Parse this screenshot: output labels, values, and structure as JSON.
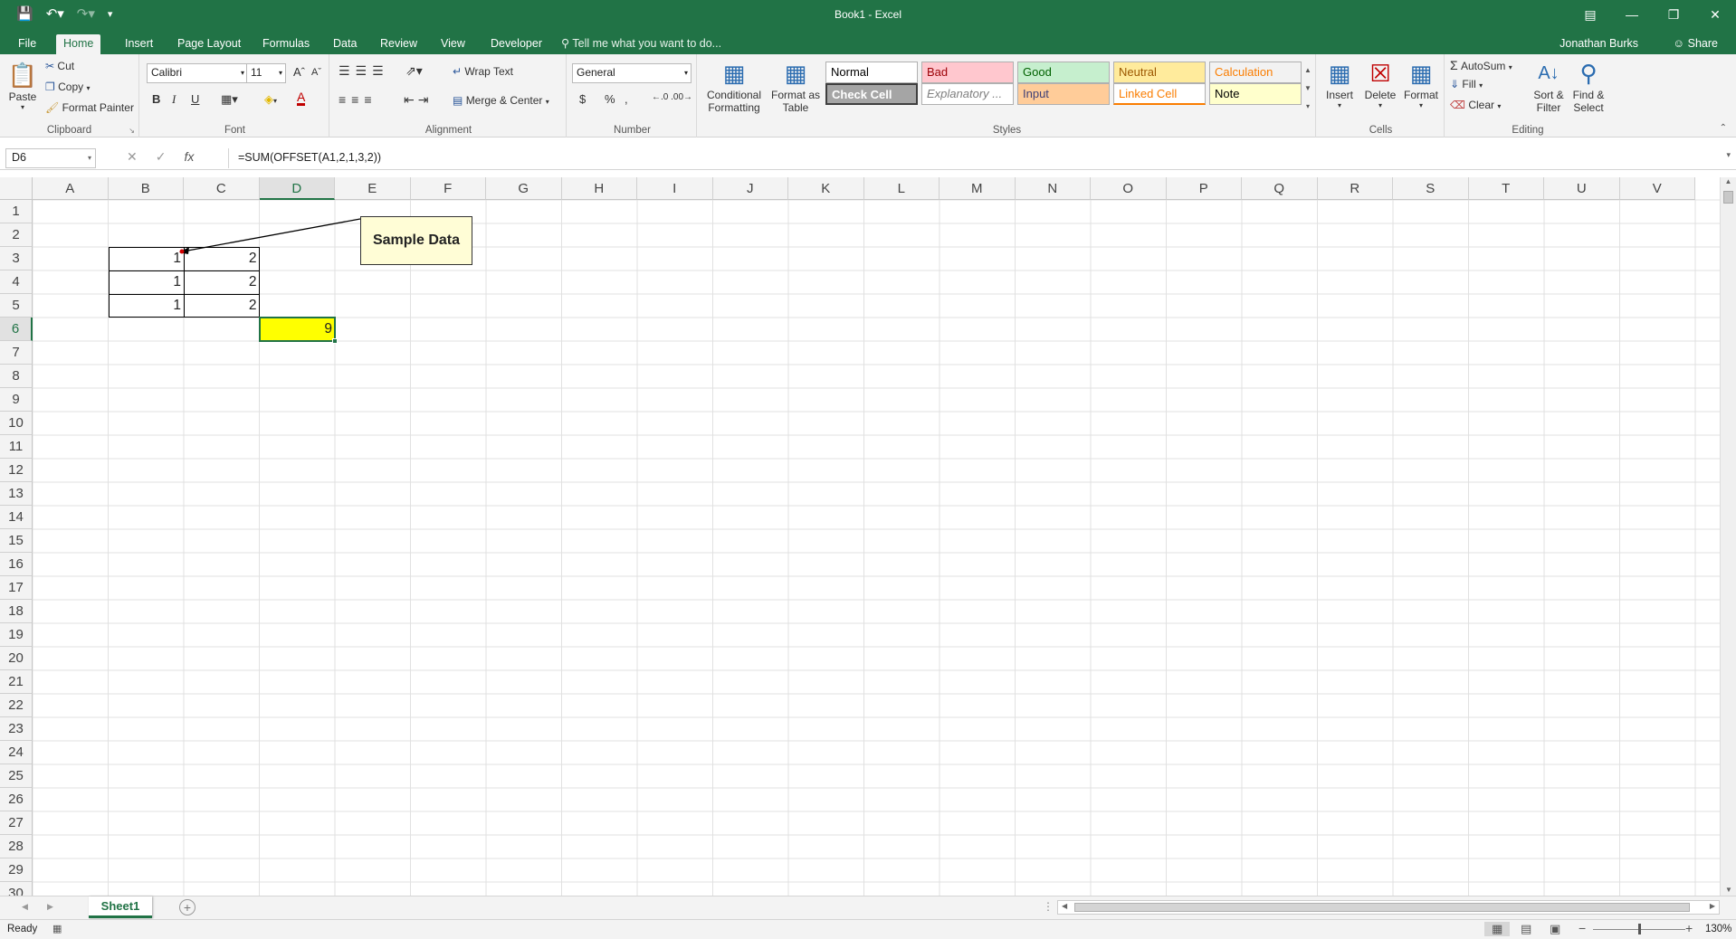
{
  "window": {
    "title": "Book1 - Excel",
    "accent_color": "#217346"
  },
  "tabs": [
    {
      "label": "File"
    },
    {
      "label": "Home"
    },
    {
      "label": "Insert"
    },
    {
      "label": "Page Layout"
    },
    {
      "label": "Formulas"
    },
    {
      "label": "Data"
    },
    {
      "label": "Review"
    },
    {
      "label": "View"
    },
    {
      "label": "Developer"
    }
  ],
  "active_tab": "Home",
  "tell_me": "Tell me what you want to do...",
  "user_name": "Jonathan Burks",
  "share_label": "Share",
  "ribbon": {
    "clipboard": {
      "label": "Clipboard",
      "paste": "Paste",
      "cut": "Cut",
      "copy": "Copy",
      "format_painter": "Format Painter"
    },
    "font": {
      "label": "Font",
      "font_name": "Calibri",
      "font_size": "11",
      "bold": "B",
      "italic": "I",
      "underline": "U"
    },
    "alignment": {
      "label": "Alignment",
      "wrap_text": "Wrap Text",
      "merge_center": "Merge & Center"
    },
    "number": {
      "label": "Number",
      "format": "General",
      "currency": "$",
      "percent": "%",
      "comma": ","
    },
    "styles": {
      "label": "Styles",
      "conditional_formatting_1": "Conditional",
      "conditional_formatting_2": "Formatting",
      "format_as_table_1": "Format as",
      "format_as_table_2": "Table",
      "cells": [
        {
          "label": "Normal",
          "bg": "#ffffff",
          "color": "#000000"
        },
        {
          "label": "Bad",
          "bg": "#ffc7ce",
          "color": "#9c0006"
        },
        {
          "label": "Good",
          "bg": "#c6efce",
          "color": "#006100"
        },
        {
          "label": "Neutral",
          "bg": "#ffeb9c",
          "color": "#9c5700"
        },
        {
          "label": "Calculation",
          "bg": "#f2f2f2",
          "color": "#fa7d00"
        },
        {
          "label": "Check Cell",
          "bg": "#a5a5a5",
          "color": "#ffffff"
        },
        {
          "label": "Explanatory ...",
          "bg": "#ffffff",
          "color": "#7f7f7f"
        },
        {
          "label": "Input",
          "bg": "#ffcc99",
          "color": "#3f3f76"
        },
        {
          "label": "Linked Cell",
          "bg": "#ffffff",
          "color": "#fa7d00"
        },
        {
          "label": "Note",
          "bg": "#ffffcc",
          "color": "#000000"
        }
      ]
    },
    "cells": {
      "label": "Cells",
      "insert": "Insert",
      "delete": "Delete",
      "format": "Format"
    },
    "editing": {
      "label": "Editing",
      "autosum": "AutoSum",
      "fill": "Fill",
      "clear": "Clear",
      "sort_filter_1": "Sort &",
      "sort_filter_2": "Filter",
      "find_select_1": "Find &",
      "find_select_2": "Select"
    }
  },
  "formula_bar": {
    "name_box": "D6",
    "fx": "fx",
    "formula": "=SUM(OFFSET(A1,2,1,3,2))"
  },
  "grid": {
    "columns": [
      "A",
      "B",
      "C",
      "D",
      "E",
      "F",
      "G",
      "H",
      "I",
      "J",
      "K",
      "L",
      "M",
      "N",
      "O",
      "P",
      "Q",
      "R",
      "S",
      "T",
      "U",
      "V"
    ],
    "rows": [
      "1",
      "2",
      "3",
      "4",
      "5",
      "6",
      "7",
      "8",
      "9",
      "10",
      "11",
      "12",
      "13",
      "14",
      "15",
      "16",
      "17",
      "18",
      "19",
      "20",
      "21",
      "22",
      "23",
      "24",
      "25",
      "26",
      "27",
      "28",
      "29",
      "30"
    ],
    "selected_column": "D",
    "selected_row": "6",
    "cells": [
      {
        "ref": "B3",
        "value": "1"
      },
      {
        "ref": "C3",
        "value": "2"
      },
      {
        "ref": "B4",
        "value": "1"
      },
      {
        "ref": "C4",
        "value": "2"
      },
      {
        "ref": "B5",
        "value": "1"
      },
      {
        "ref": "C5",
        "value": "2"
      },
      {
        "ref": "D6",
        "value": "9",
        "fill": "#ffff00"
      }
    ],
    "callout": "Sample Data"
  },
  "sheet_tabs": [
    {
      "label": "Sheet1"
    }
  ],
  "status": {
    "ready": "Ready",
    "zoom": "130%"
  }
}
